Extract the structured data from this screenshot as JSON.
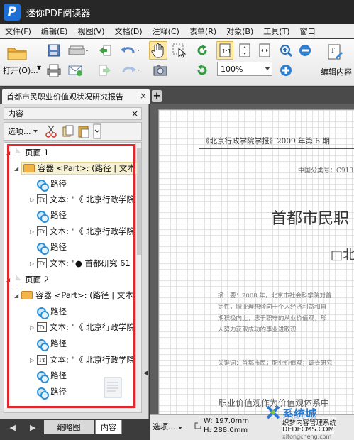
{
  "window": {
    "logo_letter": "P",
    "title": "迷你PDF阅读器"
  },
  "menu": [
    "文件(F)",
    "编辑(E)",
    "视图(V)",
    "文档(D)",
    "注释(C)",
    "表单(R)",
    "对象(B)",
    "工具(T)",
    "窗口"
  ],
  "toolbar": {
    "open_label": "打开(O)...",
    "zoom_value": "100%",
    "edit_content_label": "编辑内容"
  },
  "tabs": {
    "document_tab": "首都市民职业价值观状况研究报告",
    "close_glyph": "×",
    "new_tab_glyph": "+"
  },
  "panel": {
    "title": "内容",
    "close_glyph": "×",
    "options_label": "选项...",
    "tree": [
      {
        "type": "page",
        "label": "页面 1",
        "twisty": "◢"
      },
      {
        "type": "container",
        "label": "容器 <Part>: (路径 | 文本",
        "twisty": "◢"
      },
      {
        "type": "path",
        "label": "路径"
      },
      {
        "type": "text",
        "label": "文本: \"《 北京行政学院",
        "twisty": "▷"
      },
      {
        "type": "path",
        "label": "路径"
      },
      {
        "type": "text",
        "label": "文本: \"《 北京行政学院",
        "twisty": "▷"
      },
      {
        "type": "path",
        "label": "路径"
      },
      {
        "type": "text",
        "label": "文本: \"● 首都研究 61",
        "twisty": "▷"
      },
      {
        "type": "page",
        "label": "页面 2",
        "twisty": "◢"
      },
      {
        "type": "container",
        "label": "容器 <Part>: (路径 | 文本",
        "twisty": "◢"
      },
      {
        "type": "path",
        "label": "路径"
      },
      {
        "type": "text",
        "label": "文本: \"《 北京行政学院",
        "twisty": "▷"
      },
      {
        "type": "path",
        "label": "路径"
      },
      {
        "type": "text",
        "label": "文本: \"《 北京行政学院",
        "twisty": "▷"
      },
      {
        "type": "path",
        "label": "路径"
      },
      {
        "type": "path",
        "label": "路径"
      }
    ],
    "bottom_tabs": {
      "thumbnails": "缩略图",
      "content": "内容"
    }
  },
  "document": {
    "journal": "《北京行政学院学报》2009 年第 6 期",
    "class_no": "中国分类号：C913.2",
    "title": "首都市民职",
    "subtitle": "□北",
    "abstract_lines": [
      "摘　要：2008 年，北京市社会科学院对首",
      "定性，职业理想倾向于个人经济利益和自",
      "期积极向上，忠于职守的从业价值观，形",
      "人努力获取成功的事业进取观"
    ],
    "keywords": "关键词：首都市民；职业价值观；调查研究",
    "section": "职业价值观作为价值观体系中"
  },
  "status": {
    "options_label": "选项...",
    "width": "W: 197.0mm",
    "height": "H: 288.0mm"
  },
  "watermark": {
    "brand": "系统城",
    "line1": "织梦内容管理系统",
    "line2": "DEDECMS.COM",
    "line3": "xitongcheng.com"
  },
  "colors": {
    "highlight_frame": "#e2262b",
    "accent": "#1d6fd6"
  }
}
